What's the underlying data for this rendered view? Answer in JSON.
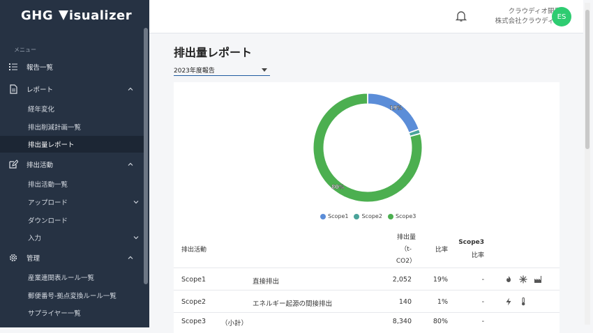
{
  "app": {
    "logo_pre": "GHG ",
    "logo_post": "isualizer"
  },
  "sidebar": {
    "caption": "メニュー",
    "reports_list": "報告一覧",
    "report": {
      "label": "レポート",
      "children": [
        "経年変化",
        "排出削減計画一覧",
        "排出量レポート"
      ]
    },
    "activity": {
      "label": "排出活動",
      "children": [
        "排出活動一覧",
        "アップロード",
        "ダウンロード",
        "入力"
      ]
    },
    "admin": {
      "label": "管理",
      "children": [
        "産業連関表ルール一覧",
        "郵便番号-拠点変換ルール一覧",
        "サプライヤー一覧"
      ]
    }
  },
  "header": {
    "company_line1": "クラウディオ開発",
    "company_line2": "株式会社クラウディオ",
    "avatar": "ES"
  },
  "main": {
    "title": "排出量レポート",
    "report_select": "2023年度報告"
  },
  "chart_data": {
    "type": "pie",
    "donut": true,
    "categories": [
      "Scope1",
      "Scope2",
      "Scope3"
    ],
    "values": [
      2052,
      140,
      8340
    ],
    "percent_labels": [
      "19%",
      "",
      "80%"
    ],
    "colors": [
      "#5b8dd8",
      "#4aa39a",
      "#4caf50"
    ],
    "legend_position": "bottom"
  },
  "table": {
    "headers": {
      "activity": "排出活動",
      "amount_l1": "排出量",
      "amount_l2": "（t-",
      "amount_l3": "CO2）",
      "ratio": "比率",
      "scope3_l1": "Scope3",
      "scope3_l2": "比率"
    },
    "rows": [
      {
        "scope": "Scope1",
        "name": "直接排出",
        "amount": "2,052",
        "ratio": "19%",
        "s3": "-"
      },
      {
        "scope": "Scope2",
        "name": "エネルギー起源の間接排出",
        "amount": "140",
        "ratio": "1%",
        "s3": "-"
      },
      {
        "scope": "Scope3",
        "name": "（小計）",
        "amount": "8,340",
        "ratio": "80%",
        "s3": "-"
      }
    ],
    "row_icons": [
      [
        "fire-icon",
        "snowflake-icon",
        "factory-icon"
      ],
      [
        "bolt-icon",
        "thermometer-icon"
      ],
      []
    ]
  }
}
